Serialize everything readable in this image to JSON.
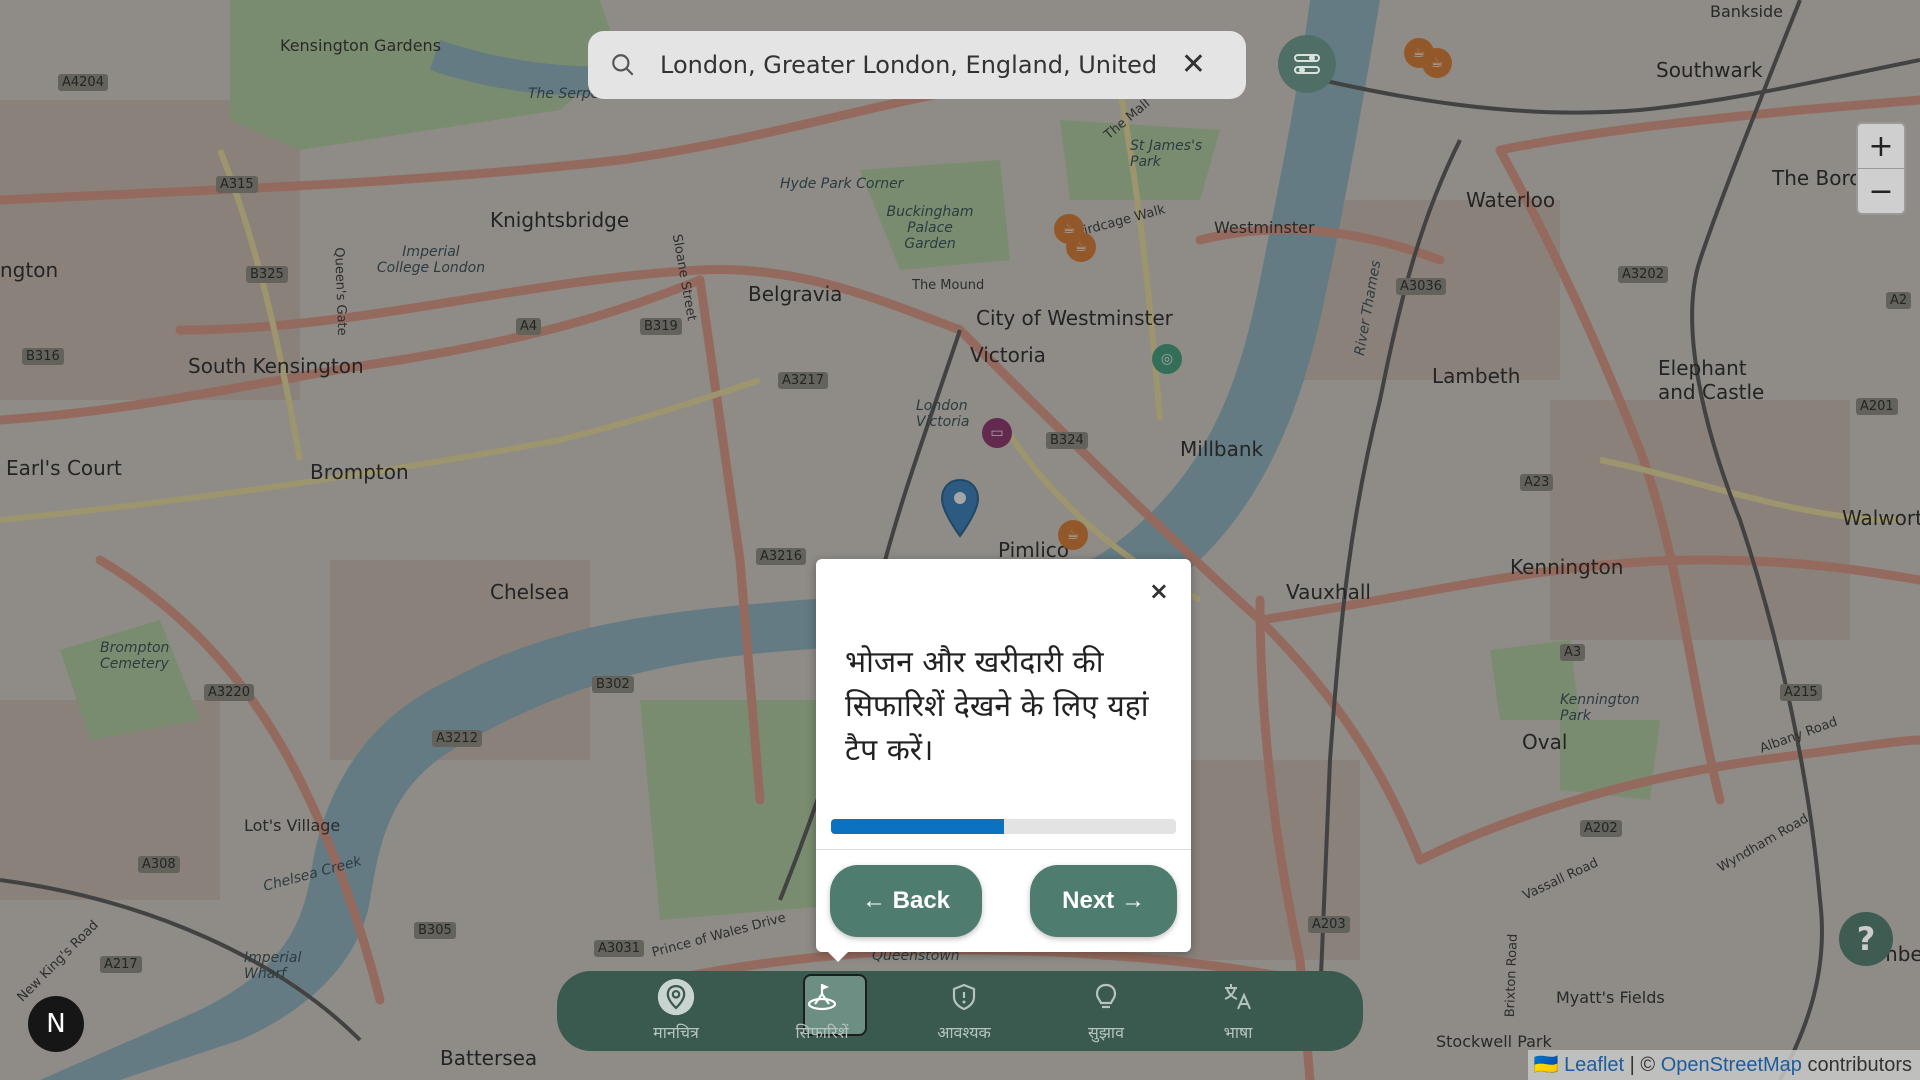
{
  "search": {
    "value": "London, Greater London, England, United Kingdom",
    "icon": "search-icon",
    "clear_icon": "close-icon",
    "clear_glyph": "✕"
  },
  "filter_button": {
    "icon": "sliders-icon"
  },
  "zoom": {
    "in": "+",
    "out": "−"
  },
  "help": {
    "label": "?"
  },
  "north": {
    "label": "N"
  },
  "map": {
    "districts": [
      "Kensington Gardens",
      "Knightsbridge",
      "Belgravia",
      "City of Westminster",
      "Victoria",
      "South Kensington",
      "Brompton",
      "Earl's Court",
      "Chelsea",
      "Pimlico",
      "Millbank",
      "Lambeth",
      "Kennington",
      "Vauxhall",
      "Waterloo",
      "Southwark",
      "Elephant and Castle",
      "Oval",
      "Battersea",
      "Lot's Village",
      "Westminster",
      "Imperial College London",
      "Buckingham Palace Garden",
      "Hyde Park Corner",
      "London Victoria",
      "Kennington Park",
      "Myatt's Fields",
      "Stockwell Park",
      "Imperial Wharf",
      "Brompton Cemetery",
      "Queenstown",
      "St James's Park",
      "Bankside",
      "The Borough",
      "Walworth",
      "Camberwell",
      "ngton"
    ],
    "roads": [
      "A4204",
      "A315",
      "B325",
      "A4",
      "B319",
      "B316",
      "A3217",
      "B324",
      "A3216",
      "B302",
      "A3220",
      "A3212",
      "B305",
      "A308",
      "A217",
      "A3031",
      "A3036",
      "A3202",
      "A201",
      "A23",
      "A3",
      "A215",
      "A202",
      "A203",
      "A2"
    ],
    "waterways": [
      "The Serpentine",
      "River Thames",
      "Chelsea Creek"
    ],
    "streets": [
      "Sloane Street",
      "Queen's Gate",
      "Birdcage Walk",
      "The Mall",
      "The Mound",
      "Prince of Wales Drive",
      "Vassall Road",
      "Wyndham Road",
      "Albany Road",
      "Brixton Road",
      "New King's Road"
    ]
  },
  "tour": {
    "close_glyph": "×",
    "message": "भोजन और खरीदारी की सिफारिशें देखने के लिए यहां टैप करें।",
    "progress": 0.5,
    "back_label": "← Back",
    "next_label": "Next →"
  },
  "nav": {
    "items": [
      {
        "label": "मानचित्र",
        "icon": "map-pin-icon",
        "active": false
      },
      {
        "label": "सिफारिशें",
        "icon": "recommendations-icon",
        "active": true
      },
      {
        "label": "आवश्यक",
        "icon": "shield-icon",
        "active": false
      },
      {
        "label": "सुझाव",
        "icon": "lightbulb-icon",
        "active": false
      },
      {
        "label": "भाषा",
        "icon": "translate-icon",
        "active": false
      }
    ]
  },
  "attribution": {
    "flag": "🇺🇦",
    "leaflet": "Leaflet",
    "sep": " | © ",
    "osm": "OpenStreetMap",
    "suffix": " contributors"
  },
  "colors": {
    "nav_bg": "#3a5a4f",
    "button_bg": "#4e7d6f",
    "progress": "#0a72c1",
    "river": "#6fa3b6",
    "primary_road": "#e8917a",
    "park": "#9fc98f"
  }
}
